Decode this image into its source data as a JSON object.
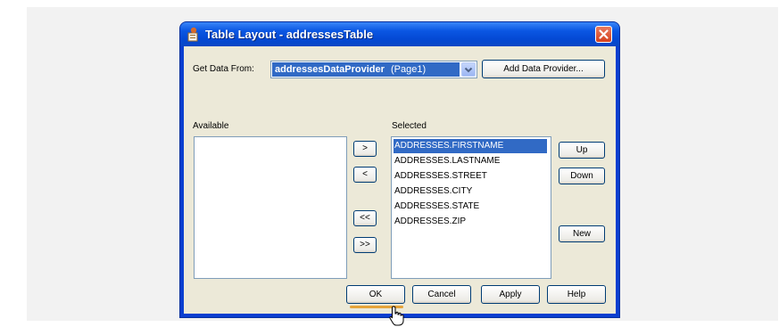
{
  "window": {
    "title": "Table Layout - addressesTable",
    "icons": {
      "app": "app-icon",
      "close": "close-icon"
    }
  },
  "data_source": {
    "label": "Get Data From:",
    "combo": {
      "provider": "addressesDataProvider",
      "page": "(Page1)",
      "dropdown_icon": "chevron-down-icon"
    },
    "add_button": "Add Data Provider..."
  },
  "available": {
    "label": "Available",
    "items": []
  },
  "transfer_buttons": {
    "add": ">",
    "remove": "<",
    "remove_all": "<<",
    "add_all": ">>"
  },
  "selected": {
    "label": "Selected",
    "items": [
      "ADDRESSES.FIRSTNAME",
      "ADDRESSES.LASTNAME",
      "ADDRESSES.STREET",
      "ADDRESSES.CITY",
      "ADDRESSES.STATE",
      "ADDRESSES.ZIP"
    ],
    "selected_index": 0
  },
  "order_buttons": {
    "up": "Up",
    "down": "Down",
    "new": "New"
  },
  "footer": {
    "ok": "OK",
    "cancel": "Cancel",
    "apply": "Apply",
    "help": "Help"
  },
  "colors": {
    "title_bar": "#0b57e3",
    "selection": "#316ac5",
    "dialog_face": "#ece9d8"
  }
}
